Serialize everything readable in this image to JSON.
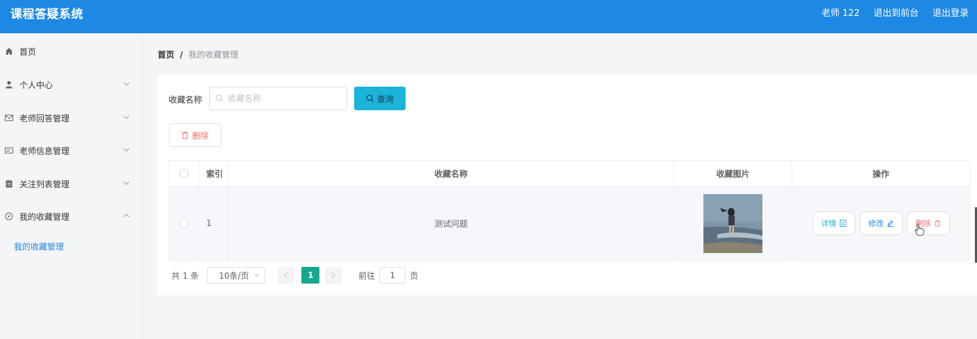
{
  "app": {
    "title": "课程答疑系统"
  },
  "topbar": {
    "user": "老师 122",
    "to_front": "退出到前台",
    "logout": "退出登录"
  },
  "sidebar": {
    "items": [
      {
        "label": "首页",
        "icon": "home-icon",
        "has_arrow": false
      },
      {
        "label": "个人中心",
        "icon": "user-icon",
        "has_arrow": true,
        "arrow": "down"
      },
      {
        "label": "老师回答管理",
        "icon": "mail-icon",
        "has_arrow": true,
        "arrow": "down"
      },
      {
        "label": "老师信息管理",
        "icon": "card-icon",
        "has_arrow": true,
        "arrow": "down"
      },
      {
        "label": "关注列表管理",
        "icon": "clipboard-icon",
        "has_arrow": true,
        "arrow": "down"
      },
      {
        "label": "我的收藏管理",
        "icon": "compass-icon",
        "has_arrow": true,
        "arrow": "up"
      }
    ],
    "subitem": "我的收藏管理"
  },
  "breadcrumb": {
    "home": "首页",
    "sep": "/",
    "current": "我的收藏管理"
  },
  "search": {
    "label": "收藏名称",
    "placeholder": "收藏名称",
    "button": "查询"
  },
  "toolbar": {
    "delete": "删除"
  },
  "table": {
    "headers": {
      "index": "索引",
      "name": "收藏名称",
      "image": "收藏图片",
      "ops": "操作"
    },
    "rows": [
      {
        "index": "1",
        "name": "测试问题"
      }
    ],
    "ops": {
      "detail": "详情",
      "edit": "修改",
      "delete": "删除"
    }
  },
  "pagination": {
    "total": "共 1 条",
    "page_size": "10条/页",
    "current": "1",
    "goto_prefix": "前往",
    "goto_value": "1",
    "goto_suffix": "页"
  },
  "colors": {
    "primary": "#1e88e5",
    "query": "#1bb4d8",
    "danger": "#f56c6c",
    "page": "#14a88f"
  }
}
